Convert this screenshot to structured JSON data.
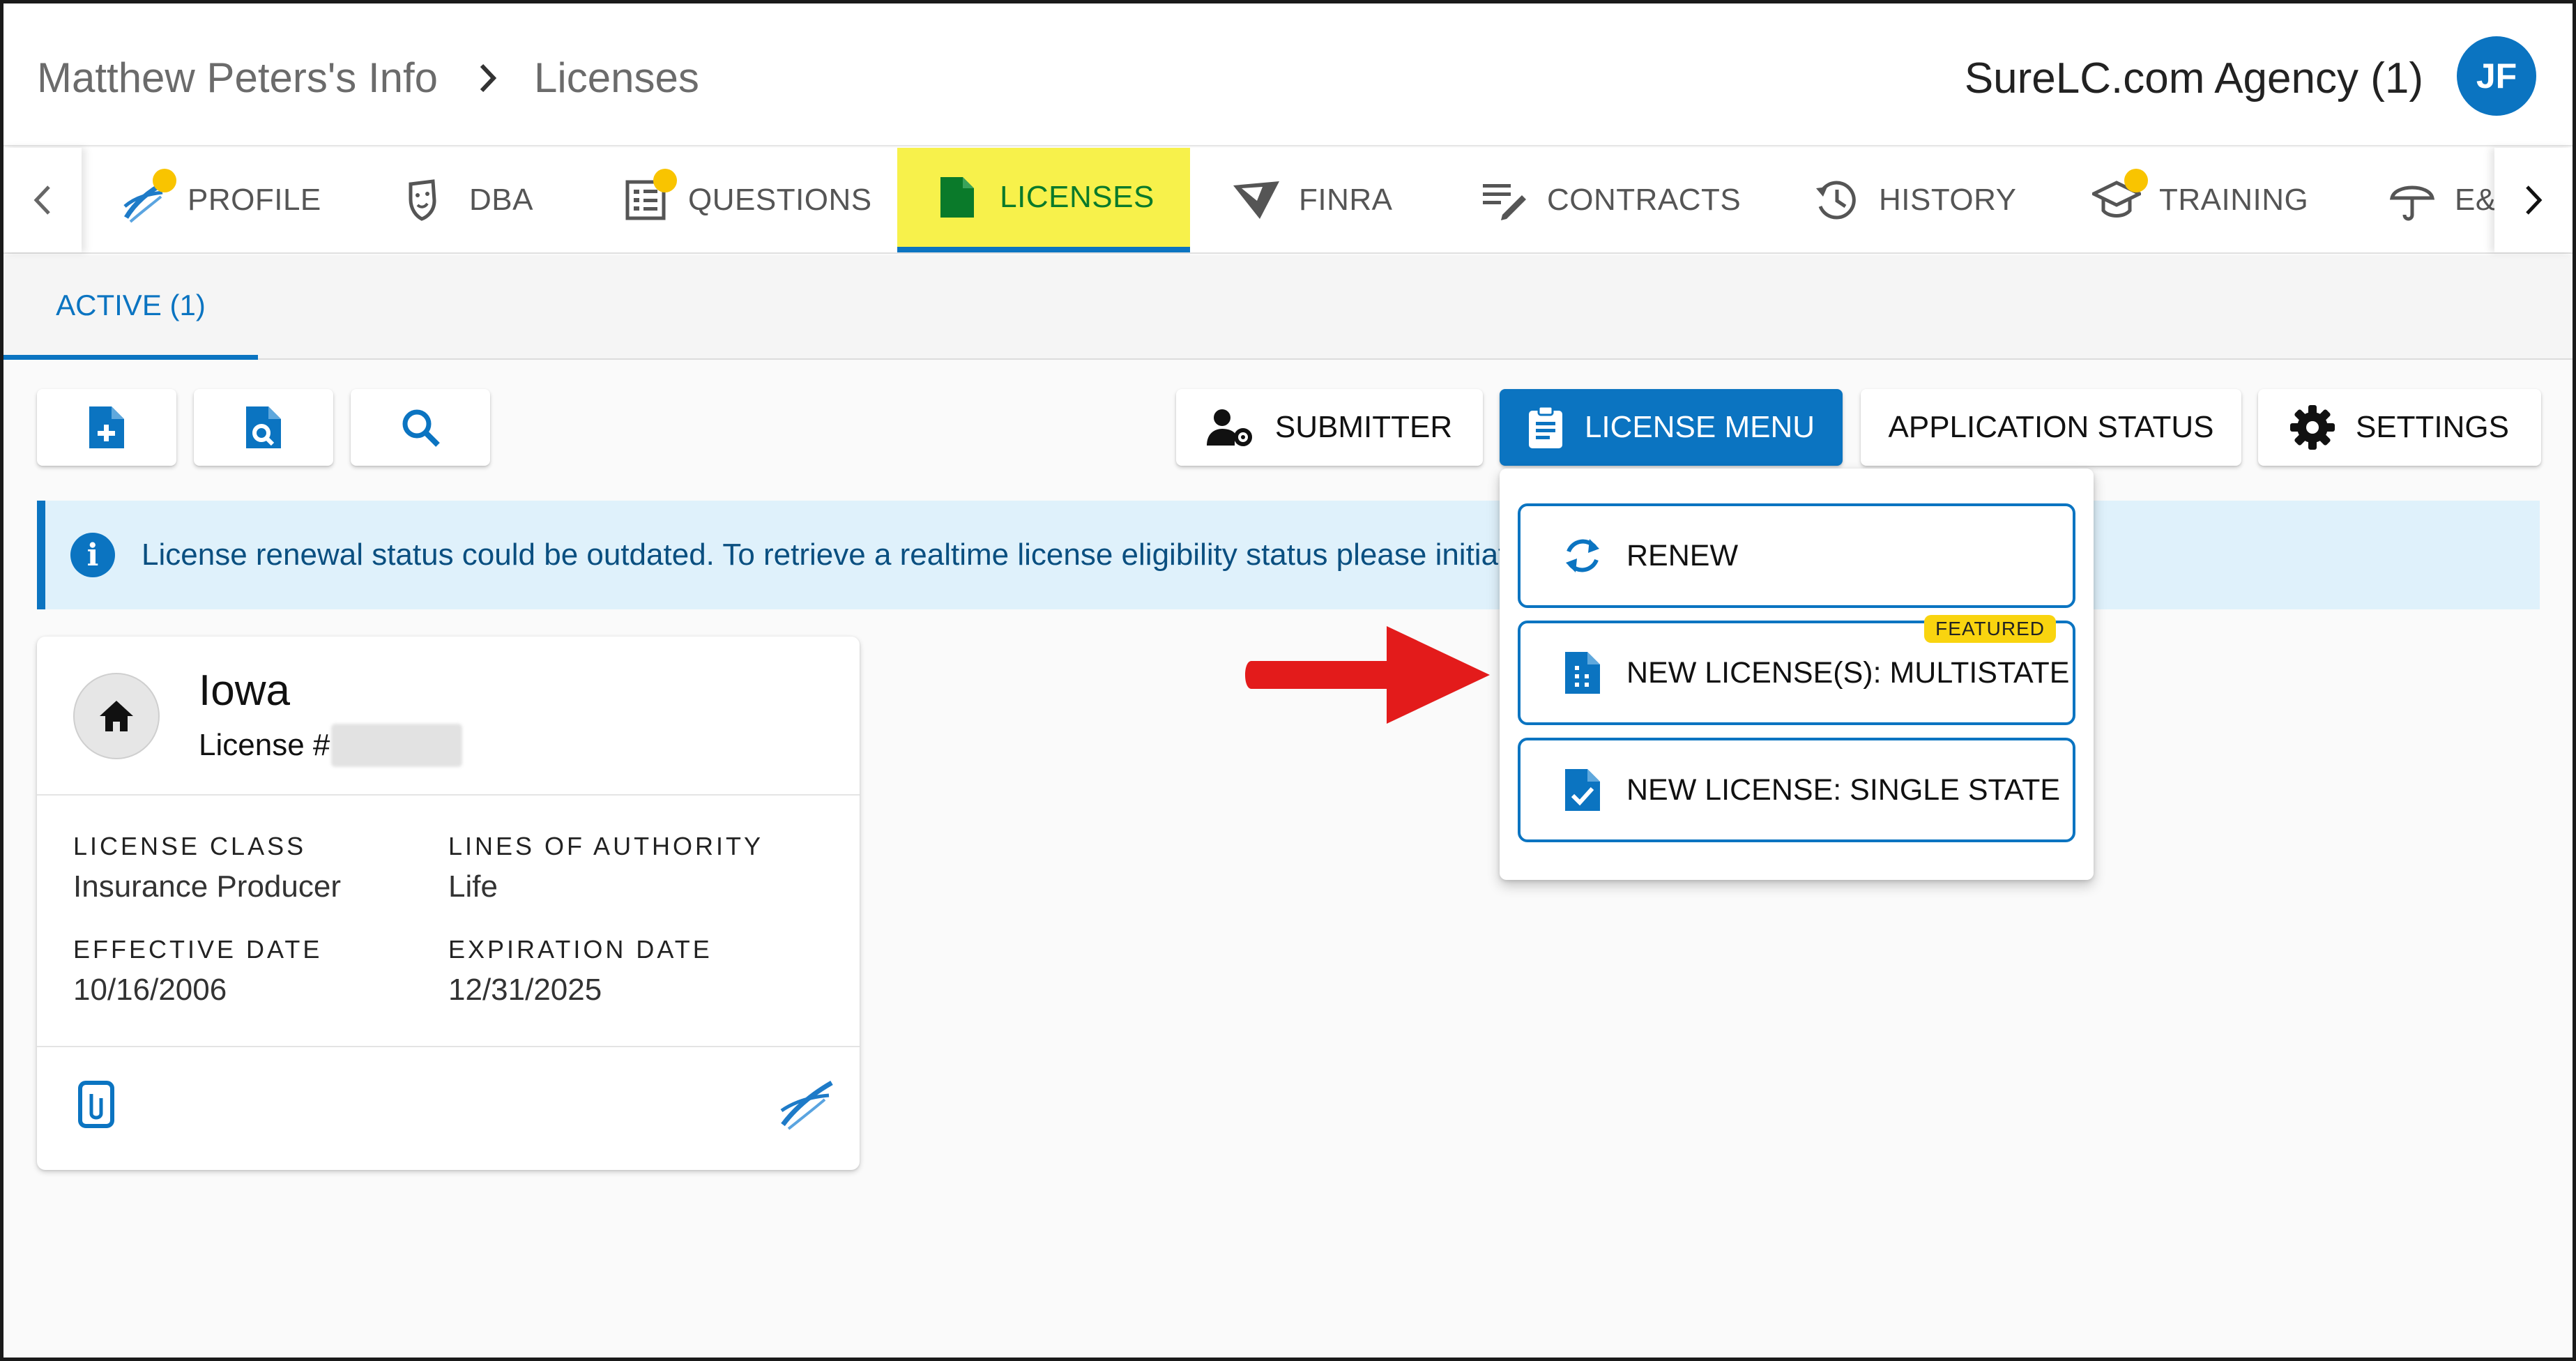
{
  "header": {
    "breadcrumb_root": "Matthew Peters's Info",
    "breadcrumb_current": "Licenses",
    "agency": "SureLC.com Agency (1)",
    "avatar_initials": "JF"
  },
  "tabs": [
    {
      "label": "PROFILE",
      "icon": "surelc-logo-icon",
      "badge": true
    },
    {
      "label": "DBA",
      "icon": "masks-icon",
      "badge": false
    },
    {
      "label": "QUESTIONS",
      "icon": "checklist-icon",
      "badge": true
    },
    {
      "label": "LICENSES",
      "icon": "document-icon",
      "badge": false,
      "active": true
    },
    {
      "label": "FINRA",
      "icon": "finra-icon",
      "badge": false
    },
    {
      "label": "CONTRACTS",
      "icon": "edit-lines-icon",
      "badge": false
    },
    {
      "label": "HISTORY",
      "icon": "history-icon",
      "badge": false
    },
    {
      "label": "TRAINING",
      "icon": "graduation-cap-icon",
      "badge": true
    },
    {
      "label": "E&",
      "icon": "umbrella-icon",
      "badge": false
    }
  ],
  "subtab": {
    "label": "ACTIVE (1)"
  },
  "toolbar": {
    "submitter": "SUBMITTER",
    "license_menu": "LICENSE MENU",
    "application_status": "APPLICATION STATUS",
    "settings": "SETTINGS"
  },
  "banner": {
    "text": "License renewal status could be outdated. To retrieve a realtime license eligibility status please initiat"
  },
  "card": {
    "state": "Iowa",
    "license_label": "License #",
    "license_class_label": "LICENSE CLASS",
    "license_class": "Insurance Producer",
    "lines_label": "LINES OF AUTHORITY",
    "lines": "Life",
    "effective_label": "EFFECTIVE DATE",
    "effective": "10/16/2006",
    "expiration_label": "EXPIRATION DATE",
    "expiration": "12/31/2025"
  },
  "menu": {
    "renew": "RENEW",
    "multistate": "NEW LICENSE(S): MULTISTATE",
    "featured": "FEATURED",
    "single_state": "NEW LICENSE: SINGLE STATE"
  },
  "colors": {
    "primary": "#0b74c1",
    "badge": "#f9c400",
    "active_tab_highlight": "#f7f14b",
    "arrow": "#e31b1b"
  }
}
